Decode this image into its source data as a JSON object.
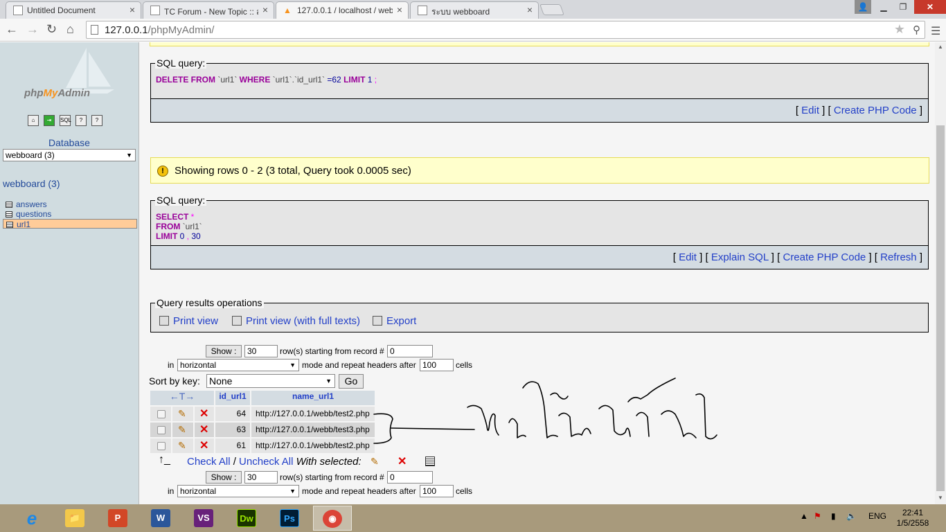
{
  "browser": {
    "tabs": [
      {
        "title": "Untitled Document",
        "close": "×"
      },
      {
        "title": "TC Forum - New Topic :: ส",
        "close": "×"
      },
      {
        "title": "127.0.0.1 / localhost / web",
        "close": "×"
      },
      {
        "title": "ระบบ webboard",
        "close": "×"
      }
    ],
    "url_host": "127.0.0.1",
    "url_path": "/phpMyAdmin/"
  },
  "nav": {
    "logo_php": "php",
    "logo_my": "My",
    "logo_admin": "Admin",
    "database_label": "Database",
    "database_select": "webboard (3)",
    "database_link": "webboard (3)",
    "tables": [
      "answers",
      "questions",
      "url1"
    ]
  },
  "delete_query": {
    "legend": "SQL query:",
    "kw1": "DELETE FROM",
    "t1": " `url1` ",
    "kw2": "WHERE",
    "t2": " `url1`.`id_url1` ",
    "eq": "=62",
    "kw3": " LIMIT",
    "n1": " 1",
    "semi": " ;",
    "links": {
      "open": "[ ",
      "edit": "Edit",
      "sep": " ] [ ",
      "php": "Create PHP Code",
      "close": " ]"
    }
  },
  "notice": {
    "message": "Showing rows 0 - 2 (3 total, Query took 0.0005 sec)"
  },
  "select_query": {
    "legend": "SQL query:",
    "kw1": "SELECT",
    "star": " *",
    "kw2": "FROM",
    "t1": " `url1`",
    "kw3": "LIMIT",
    "n1": " 0",
    "comma": " ,",
    "n2": " 30",
    "links": {
      "open": "[ ",
      "edit": "Edit",
      "sep1": " ] [ ",
      "explain": "Explain SQL",
      "sep2": " ] [ ",
      "php": "Create PHP Code",
      "sep3": " ] [ ",
      "refresh": "Refresh",
      "close": " ]"
    }
  },
  "ops": {
    "legend": "Query results operations",
    "print": "Print view",
    "print_full": "Print view (with full texts)",
    "export": "Export"
  },
  "nav_form": {
    "show_button": "Show :",
    "rows": "30",
    "rows_label": "row(s) starting from record #",
    "start": "0",
    "in_label": "in",
    "mode": "horizontal",
    "mode_label": "mode and repeat headers after",
    "repeat": "100",
    "cells_label": "cells"
  },
  "sort": {
    "label": "Sort by key:",
    "value": "None",
    "go": "Go"
  },
  "results": {
    "arrows": "←T→",
    "columns": [
      "id_url1",
      "name_url1"
    ],
    "rows": [
      {
        "id": "64",
        "name": "http://127.0.0.1/webb/test2.php"
      },
      {
        "id": "63",
        "name": "http://127.0.0.1/webb/test3.php"
      },
      {
        "id": "61",
        "name": "http://127.0.0.1/webb/test2.php"
      }
    ]
  },
  "bulk": {
    "check_all": "Check All",
    "slash": " / ",
    "uncheck_all": "Uncheck All",
    "with_selected": "With selected:"
  },
  "taskbar": {
    "apps": [
      "e",
      "📁",
      "P",
      "W",
      "VS",
      "Dw",
      "Ps",
      "◉"
    ],
    "lang": "ENG",
    "time": "22:41",
    "date": "1/5/2558"
  },
  "colors": {
    "keyword": "#990099",
    "link": "#2340c8",
    "notice_bg": "#ffffcc",
    "nav_bg": "#d0dce0"
  }
}
